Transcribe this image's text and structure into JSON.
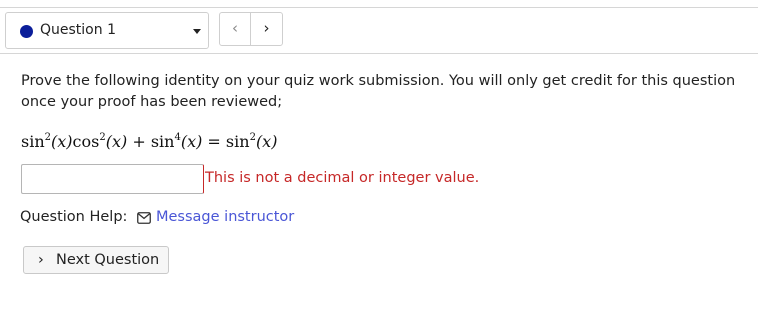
{
  "question_nav": {
    "selected": "Question 1",
    "status_color": "#0b1e9a",
    "prev_glyph": "‹",
    "next_glyph": "›"
  },
  "question": {
    "prompt": "Prove the following identity on your quiz work submission. You will only get credit for this question once your proof has been reviewed;",
    "equation": {
      "lhs_term1_fn": "sin",
      "lhs_term1_exp": "2",
      "lhs_term1_arg": "(x)",
      "lhs_term2_fn": "cos",
      "lhs_term2_exp": "2",
      "lhs_term2_arg": "(x)",
      "plus": " + ",
      "lhs_term3_fn": "sin",
      "lhs_term3_exp": "4",
      "lhs_term3_arg": "(x)",
      "equals": " = ",
      "rhs_fn": "sin",
      "rhs_exp": "2",
      "rhs_arg": "(x)"
    },
    "answer_value": "",
    "error_message": "This is not a decimal or integer value."
  },
  "help": {
    "label": "Question Help:",
    "icon": "mail-icon",
    "link_text": "Message instructor",
    "link_color": "#4a56d6"
  },
  "next_button": {
    "chevron": "›",
    "label": "Next Question"
  }
}
